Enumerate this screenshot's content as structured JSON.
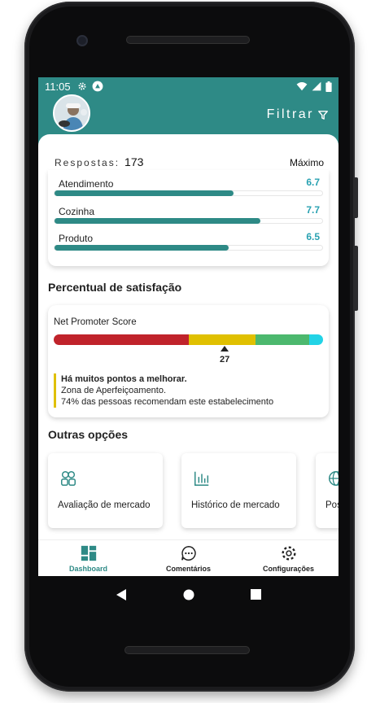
{
  "status_bar": {
    "time": "11:05",
    "icons_left": [
      "gear-icon",
      "android-icon"
    ],
    "icons_right": [
      "wifi-icon",
      "signal-icon",
      "battery-icon"
    ]
  },
  "header": {
    "filter_label": "Filtrar",
    "filter_icon": "funnel-icon"
  },
  "summary": {
    "responses_label": "Respostas:",
    "responses_count": "173",
    "max_label": "Máximo",
    "metrics": [
      {
        "label": "Atendimento",
        "value": "6.7",
        "fill": 0.67
      },
      {
        "label": "Cozinha",
        "value": "7.7",
        "fill": 0.77
      },
      {
        "label": "Produto",
        "value": "6.5",
        "fill": 0.65
      }
    ]
  },
  "satisfaction": {
    "section_title": "Percentual de satisfação",
    "nps_title": "Net Promoter Score",
    "score": "27",
    "score_position": 0.635,
    "segments": [
      {
        "color": "#c0232b",
        "share": 0.5
      },
      {
        "color": "#e0c000",
        "share": 0.25
      },
      {
        "color": "#4cb86e",
        "share": 0.2
      },
      {
        "color": "#22d3e6",
        "share": 0.05
      }
    ],
    "message_title": "Há muitos pontos a melhorar.",
    "message_zone": "Zona de Aperfeiçoamento.",
    "message_detail": "74% das pessoas recomendam este estabelecimento"
  },
  "options": {
    "section_title": "Outras opções",
    "items": [
      {
        "label": "Avaliação de mercado",
        "icon": "users-icon"
      },
      {
        "label": "Histórico de mercado",
        "icon": "bar-chart-icon"
      },
      {
        "label": "Pos",
        "icon": "globe-icon"
      }
    ]
  },
  "bottom_nav": [
    {
      "label": "Dashboard",
      "icon": "dashboard-icon",
      "active": true
    },
    {
      "label": "Comentários",
      "icon": "chat-icon",
      "active": false
    },
    {
      "label": "Configurações",
      "icon": "settings-icon",
      "active": false
    }
  ],
  "colors": {
    "accent": "#2e8a86",
    "metric_value": "#2aa2b2"
  }
}
